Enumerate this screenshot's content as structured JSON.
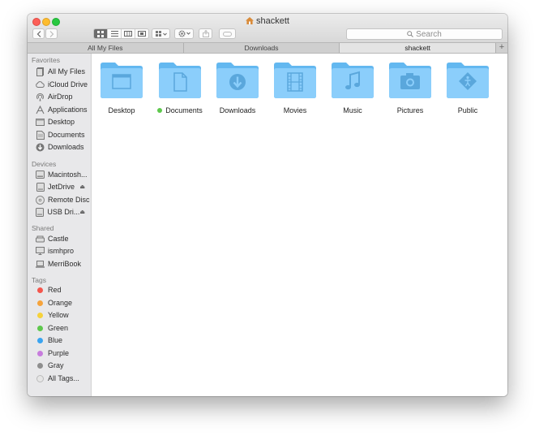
{
  "window": {
    "title": "shackett"
  },
  "toolbar": {
    "search_placeholder": "Search"
  },
  "tabs": [
    {
      "label": "All My Files"
    },
    {
      "label": "Downloads"
    },
    {
      "label": "shackett"
    }
  ],
  "tab_add_label": "+",
  "sidebar": {
    "favorites_title": "Favorites",
    "favorites": [
      {
        "label": "All My Files",
        "icon": "all-files-icon"
      },
      {
        "label": "iCloud Drive",
        "icon": "cloud-icon"
      },
      {
        "label": "AirDrop",
        "icon": "airdrop-icon"
      },
      {
        "label": "Applications",
        "icon": "applications-icon"
      },
      {
        "label": "Desktop",
        "icon": "desktop-icon"
      },
      {
        "label": "Documents",
        "icon": "documents-icon"
      },
      {
        "label": "Downloads",
        "icon": "downloads-icon"
      }
    ],
    "devices_title": "Devices",
    "devices": [
      {
        "label": "Macintosh...",
        "icon": "hard-drive-icon"
      },
      {
        "label": "JetDrive",
        "icon": "drive-icon",
        "eject": "⏏"
      },
      {
        "label": "Remote Disc",
        "icon": "disc-icon"
      },
      {
        "label": "USB Dri...",
        "icon": "drive-icon",
        "eject": "⏏"
      }
    ],
    "shared_title": "Shared",
    "shared": [
      {
        "label": "Castle",
        "icon": "network-drive-icon"
      },
      {
        "label": "ismhpro",
        "icon": "monitor-icon"
      },
      {
        "label": "MerriBook",
        "icon": "laptop-icon"
      }
    ],
    "tags_title": "Tags",
    "tags": [
      {
        "label": "Red",
        "color": "#f4554c"
      },
      {
        "label": "Orange",
        "color": "#f6a33b"
      },
      {
        "label": "Yellow",
        "color": "#f6d23b"
      },
      {
        "label": "Green",
        "color": "#5ec84d"
      },
      {
        "label": "Blue",
        "color": "#3aa4f0"
      },
      {
        "label": "Purple",
        "color": "#c77cdd"
      },
      {
        "label": "Gray",
        "color": "#8e8e8e"
      },
      {
        "label": "All Tags...",
        "color": "#e6e6e6"
      }
    ]
  },
  "folders": [
    {
      "label": "Desktop",
      "glyph": "window"
    },
    {
      "label": "Documents",
      "glyph": "document",
      "tag_color": "#5ec84d"
    },
    {
      "label": "Downloads",
      "glyph": "download"
    },
    {
      "label": "Movies",
      "glyph": "film"
    },
    {
      "label": "Music",
      "glyph": "note"
    },
    {
      "label": "Pictures",
      "glyph": "camera"
    },
    {
      "label": "Public",
      "glyph": "public"
    }
  ]
}
